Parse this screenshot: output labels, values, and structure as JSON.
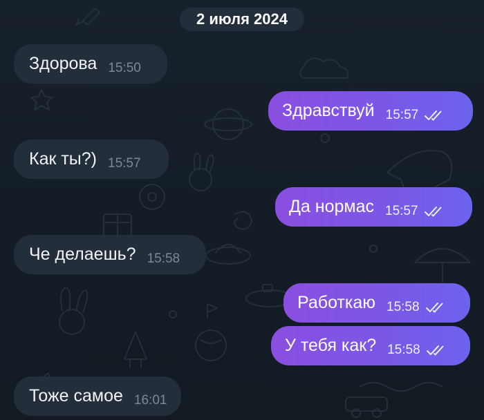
{
  "date_separator": "2 июля 2024",
  "messages": [
    {
      "direction": "incoming",
      "text": "Здорова",
      "time": "15:50"
    },
    {
      "direction": "outgoing",
      "text": "Здравствуй",
      "time": "15:57",
      "status": "read"
    },
    {
      "direction": "incoming",
      "text": "Как ты?)",
      "time": "15:57"
    },
    {
      "direction": "outgoing",
      "text": "Да нормас",
      "time": "15:57",
      "status": "read"
    },
    {
      "direction": "incoming",
      "text": "Че делаешь?",
      "time": "15:58"
    },
    {
      "direction": "outgoing",
      "text": "Работкаю",
      "time": "15:58",
      "status": "read"
    },
    {
      "direction": "outgoing",
      "text": "У тебя как?",
      "time": "15:58",
      "status": "read"
    },
    {
      "direction": "incoming",
      "text": "Тоже самое",
      "time": "16:01"
    }
  ],
  "icons": {
    "read_receipt": "double-check-icon"
  },
  "colors": {
    "background": "#17212b",
    "incoming_bubble": "#232e3b",
    "outgoing_bubble_start": "#8a4fe0",
    "outgoing_bubble_end": "#6c63ee"
  }
}
